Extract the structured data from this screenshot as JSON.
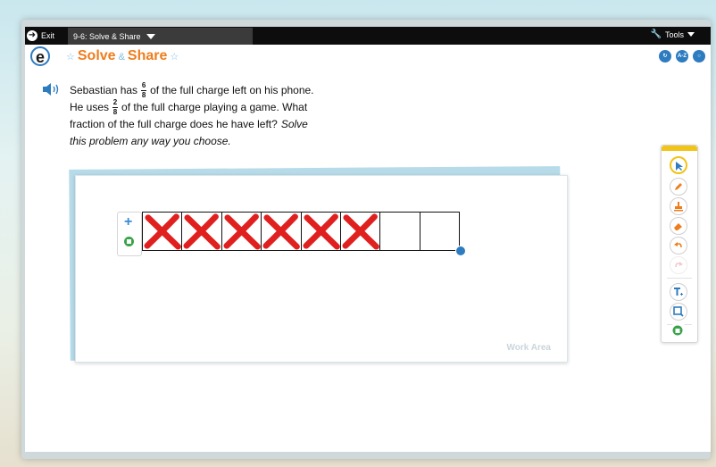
{
  "topbar": {
    "exit_label": "Exit",
    "lesson_label": "9-6: Solve & Share",
    "tools_label": "Tools"
  },
  "header": {
    "title_main": "Solve",
    "title_amp": "&",
    "title_end": "Share",
    "logo_letter": "e",
    "buttons": [
      "audio-replay",
      "A-Z",
      "help"
    ]
  },
  "question": {
    "line1_pre": "Sebastian has",
    "frac1": {
      "num": "6",
      "den": "8"
    },
    "line1_post": "of the full charge left on his phone.",
    "line2_pre": "He uses",
    "frac2": {
      "num": "2",
      "den": "8"
    },
    "line2_post": "of the full charge playing a game. What",
    "line3": "fraction of the full charge does he have left?",
    "line3_italic": "Solve",
    "line4_italic": "this problem any way you choose."
  },
  "work_area": {
    "label": "Work Area",
    "fraction_bar": {
      "total_parts": 8,
      "crossed_parts": 6,
      "mark_color": "#e0201f"
    }
  },
  "colors": {
    "accent_blue": "#2e7cc0",
    "title_orange": "#ef7d1c",
    "toolbar_yellow": "#f2c318",
    "trash_green": "#3aa34a"
  },
  "palette": {
    "tools": [
      "pointer-icon",
      "pen-icon",
      "stamp-icon",
      "eraser-icon",
      "undo-icon",
      "redo-icon",
      "text-icon",
      "zoom-icon",
      "trash-icon"
    ]
  }
}
